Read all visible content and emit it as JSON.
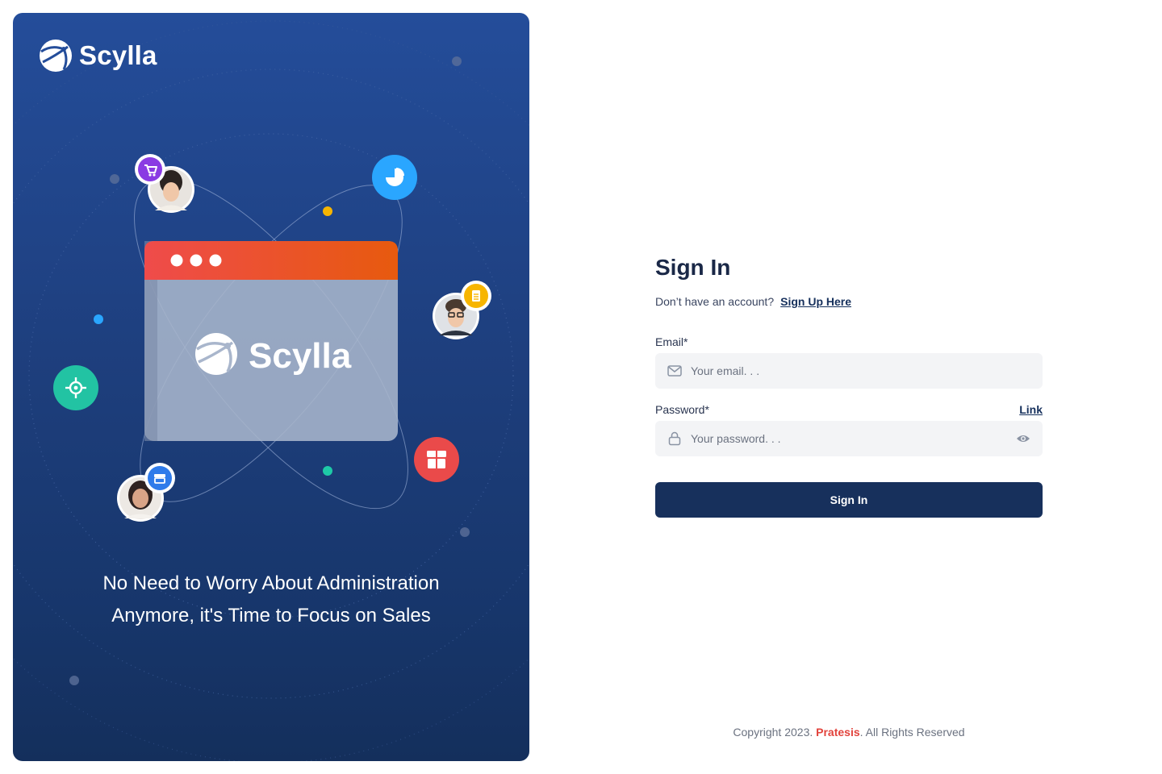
{
  "brand": {
    "name": "Scylla",
    "tagline": "No Need to Worry About Administration Anymore, it's Time to Focus on Sales"
  },
  "illustration": {
    "window_logo_text": "Scylla",
    "icons": [
      "cart-icon",
      "pie-chart-icon",
      "document-icon",
      "target-icon",
      "box-icon",
      "store-icon"
    ]
  },
  "form": {
    "title": "Sign In",
    "no_account_text": "Don’t have an account?",
    "signup_link": "Sign Up Here",
    "email_label": "Email*",
    "email_placeholder": "Your email. . .",
    "email_value": "",
    "password_label": "Password*",
    "password_link": "Link",
    "password_placeholder": "Your password. . .",
    "password_value": "",
    "submit_label": "Sign In"
  },
  "footer": {
    "prefix": "Copyright 2023.",
    "brand": "Pratesis",
    "suffix": ". All Rights Reserved"
  },
  "colors": {
    "primary": "#17305c",
    "accent_red": "#e2433c",
    "hero_top": "#244d9a",
    "hero_bottom": "#142f5c",
    "window_header_start": "#ef4b4b",
    "window_header_end": "#e75a0e"
  }
}
